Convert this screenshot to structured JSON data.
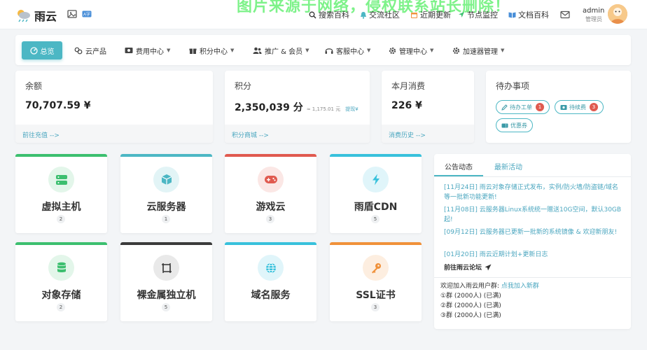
{
  "brand": {
    "name": "雨云"
  },
  "watermark": "图片来源于网络，侵权联系站长删除！",
  "topnav": [
    {
      "label": "搜索百科",
      "icon": "search-icon"
    },
    {
      "label": "交流社区",
      "icon": "bell-icon"
    },
    {
      "label": "近期更新",
      "icon": "calendar-icon"
    },
    {
      "label": "节点监控",
      "icon": "navigation-icon"
    },
    {
      "label": "文档百科",
      "icon": "book-icon"
    }
  ],
  "user": {
    "name": "admin",
    "role": "管理员"
  },
  "menu": [
    {
      "label": "总览",
      "icon": "dashboard-icon",
      "active": true
    },
    {
      "label": "云产品",
      "icon": "cloud-products-icon"
    },
    {
      "label": "费用中心",
      "icon": "billing-icon"
    },
    {
      "label": "积分中心",
      "icon": "gift-icon"
    },
    {
      "label": "推广 & 会员",
      "icon": "users-icon"
    },
    {
      "label": "客服中心",
      "icon": "headset-icon"
    },
    {
      "label": "管理中心",
      "icon": "gear-icon"
    },
    {
      "label": "加速器管理",
      "icon": "gear-icon"
    }
  ],
  "stats": {
    "balance": {
      "title": "余额",
      "value": "70,707.59 ¥",
      "link": "前往充值 -->"
    },
    "points": {
      "title": "积分",
      "value": "2,350,039 分",
      "sub": "≈ 1,175.01 元",
      "action": "提现¥",
      "link": "积分商城 -->"
    },
    "monthly": {
      "title": "本月消费",
      "value": "226 ¥",
      "link": "消费历史 -->"
    }
  },
  "todo": {
    "title": "待办事项",
    "tickets": {
      "label": "待办工单",
      "count": "1"
    },
    "renewals": {
      "label": "待续费",
      "count": "3"
    },
    "coupons": {
      "label": "优惠券"
    }
  },
  "products": [
    {
      "name": "虚拟主机",
      "count": "2",
      "icon": "server-icon",
      "color": "#3cbf6f"
    },
    {
      "name": "云服务器",
      "count": "1",
      "icon": "cube-icon",
      "color": "#4cb7c4"
    },
    {
      "name": "游戏云",
      "count": "3",
      "icon": "gamepad-icon",
      "color": "#e05a4f"
    },
    {
      "name": "雨盾CDN",
      "count": "5",
      "icon": "bolt-icon",
      "color": "#38c1dc"
    },
    {
      "name": "对象存储",
      "count": "2",
      "icon": "database-icon",
      "color": "#3cbf6f"
    },
    {
      "name": "裸金属独立机",
      "count": "5",
      "icon": "chip-icon",
      "color": "#3b3b3b"
    },
    {
      "name": "域名服务",
      "count": "",
      "icon": "globe-icon",
      "color": "#38c1dc"
    },
    {
      "name": "SSL证书",
      "count": "3",
      "icon": "key-icon",
      "color": "#f0913a"
    }
  ],
  "announcements": {
    "tabs": [
      "公告动态",
      "最新活动"
    ],
    "items": [
      "[11月24日] 雨云对象存储正式发布，实例/防火墙/防盗链/域名等一批新功能更新!",
      "[11月08日] 云服务器Linux系统统一赠送10G空间，默认30GB起!",
      "[09月12日] 云服务器已更新一批新的系统镜像 & 欢迎新朋友!",
      "[01月20日] 雨云近期计划+更新日志"
    ],
    "forum_link": "前往雨云论坛",
    "group_intro": "欢迎加入雨云用户群: ",
    "group_link": "点我加入新群",
    "groups": [
      "①群 (2000人) (已满)",
      "②群 (2000人) (已满)",
      "③群 (2000人) (已满)"
    ]
  }
}
